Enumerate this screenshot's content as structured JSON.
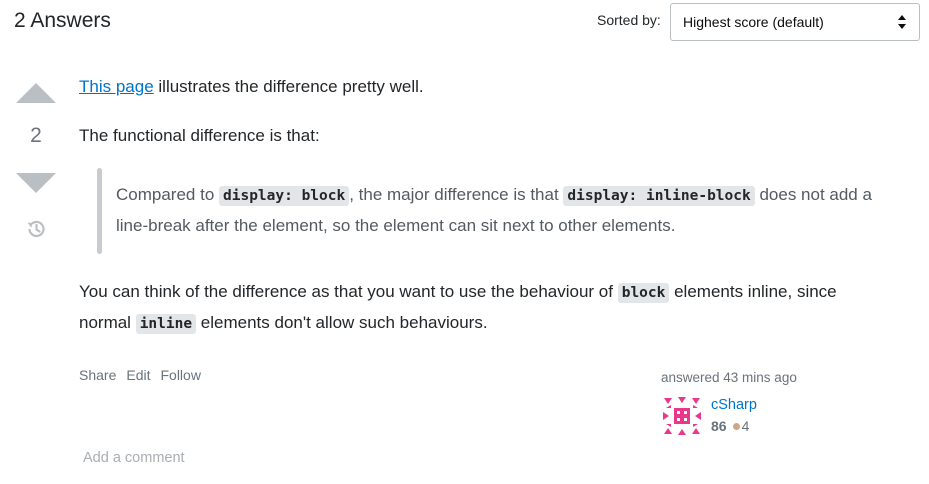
{
  "header": {
    "answers_count": "2 Answers",
    "sort_label": "Sorted by:",
    "sort_value": "Highest score (default)"
  },
  "vote": {
    "count": "2"
  },
  "post": {
    "p1_link": "This page",
    "p1_rest": " illustrates the difference pretty well.",
    "p2": "The functional difference is that:",
    "quote": {
      "t1": "Compared to ",
      "c1": "display: block",
      "t2": ", the major difference is that ",
      "c2": "display: inline-block",
      "t3": " does not add a line-break after the element, so the element can sit next to other elements."
    },
    "p3": {
      "t1": "You can think of the difference as that you want to use the behaviour of ",
      "c1": "block",
      "t2": " elements inline, since normal ",
      "c2": "inline",
      "t3": " elements don't allow such behaviours."
    }
  },
  "menu": {
    "share": "Share",
    "edit": "Edit",
    "follow": "Follow"
  },
  "user_card": {
    "answered": "answered 43 mins ago",
    "name": "cSharp",
    "reputation": "86",
    "bronze": "4",
    "bronze_color": "#d1a684"
  },
  "comments": {
    "add_comment": "Add a comment"
  },
  "colors": {
    "link": "#0074cc",
    "text": "#232629",
    "muted": "#6a737c",
    "avatar": "#e8378c"
  }
}
